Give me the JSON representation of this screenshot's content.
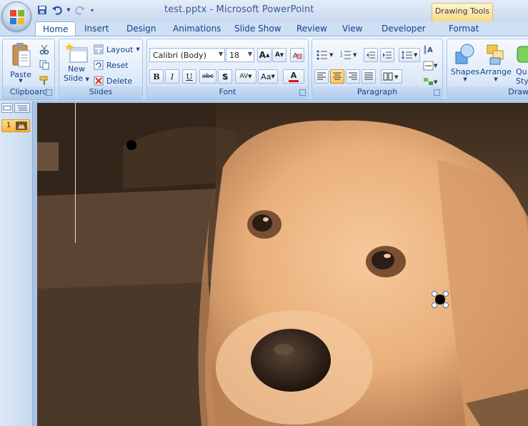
{
  "window": {
    "title": "test.pptx - Microsoft PowerPoint",
    "contextual_tab_group": "Drawing Tools"
  },
  "tabs": [
    {
      "label": "Home",
      "active": true
    },
    {
      "label": "Insert"
    },
    {
      "label": "Design"
    },
    {
      "label": "Animations"
    },
    {
      "label": "Slide Show"
    },
    {
      "label": "Review"
    },
    {
      "label": "View"
    },
    {
      "label": "Developer"
    },
    {
      "label": "Format"
    }
  ],
  "ribbon": {
    "clipboard": {
      "label": "Clipboard",
      "paste": "Paste"
    },
    "slides": {
      "label": "Slides",
      "new_slide_line1": "New",
      "new_slide_line2": "Slide",
      "layout": "Layout",
      "reset": "Reset",
      "delete": "Delete"
    },
    "font": {
      "label": "Font",
      "font_name": "Calibri (Body)",
      "font_size": "18",
      "bold": "B",
      "italic": "I",
      "underline": "U",
      "strike": "abc",
      "shadow": "S",
      "spacing": "AV",
      "case": "Aa",
      "color": "A",
      "grow": "A",
      "shrink": "A"
    },
    "paragraph": {
      "label": "Paragraph"
    },
    "drawing": {
      "label": "Draw",
      "shapes": "Shapes",
      "arrange": "Arrange",
      "quick_styles_1": "Qu",
      "quick_styles_2": "Style"
    }
  },
  "left_pane": {
    "slide_number": "1"
  },
  "colors": {
    "accent": "#15428b",
    "ribbon_border": "#8db2e3",
    "font_color_bar": "#e0141e"
  }
}
